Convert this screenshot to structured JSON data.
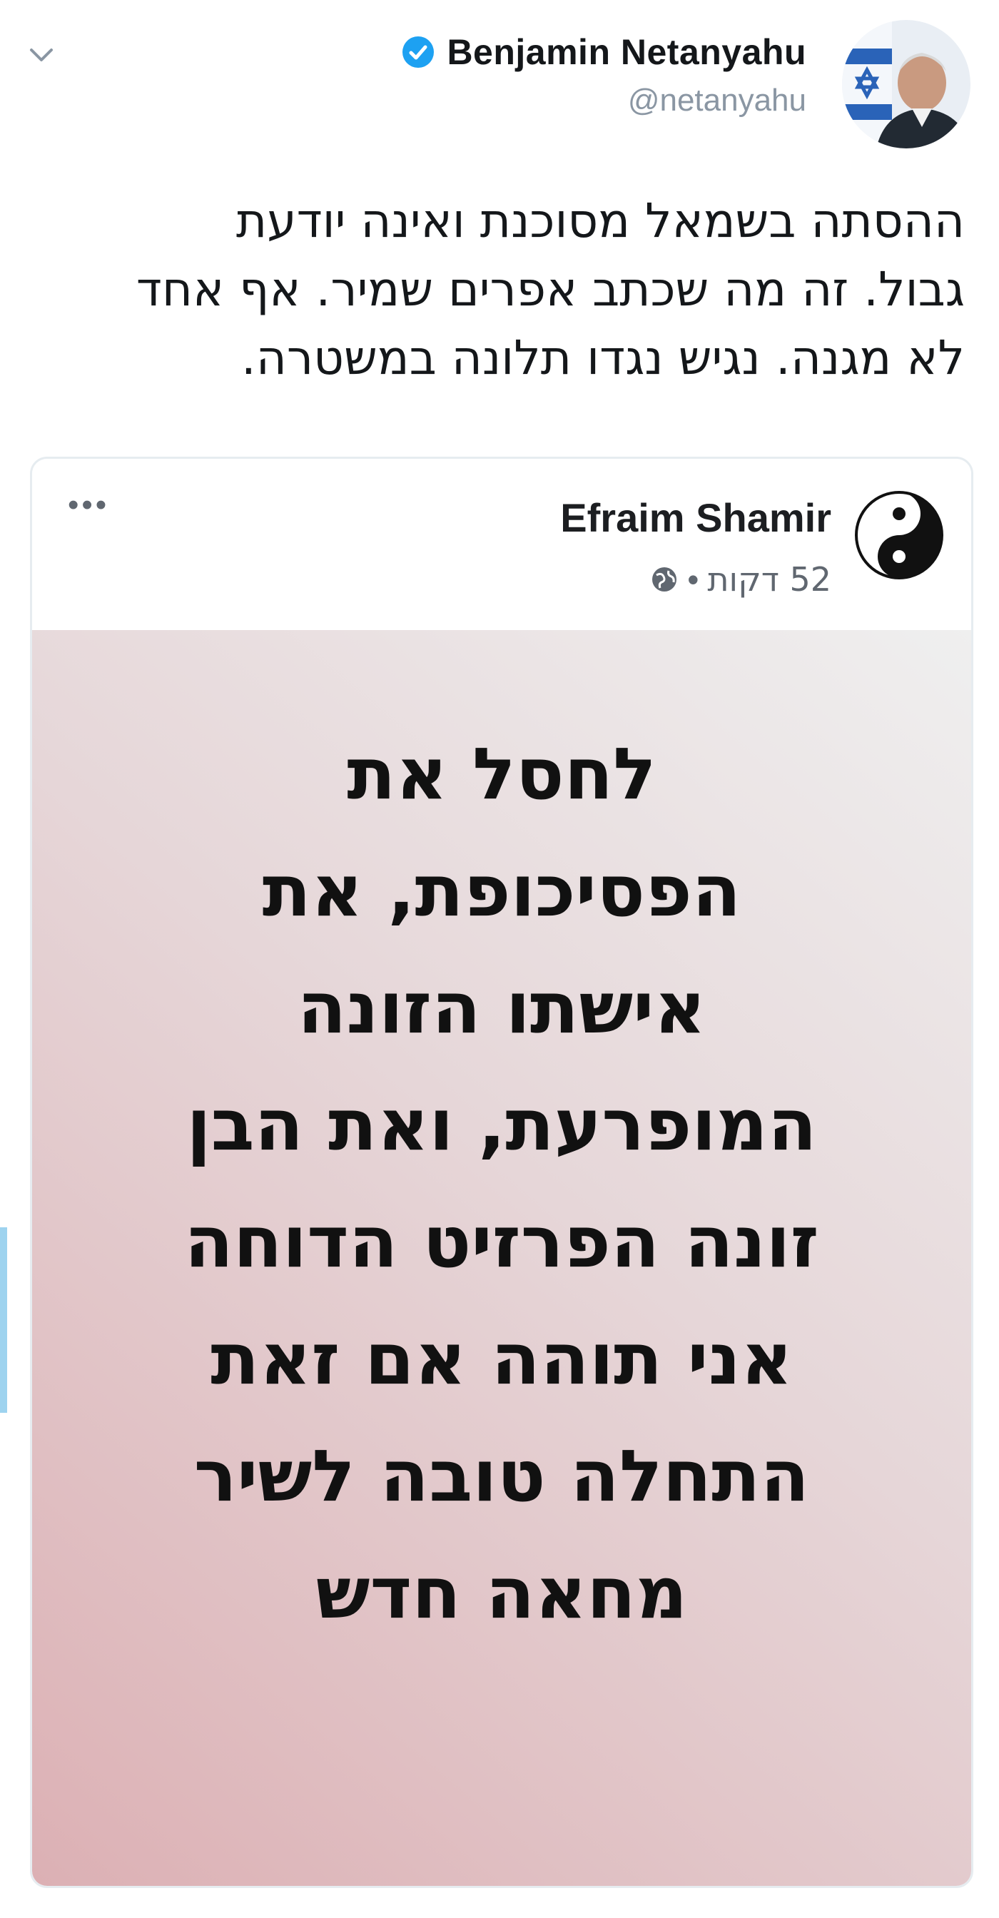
{
  "tweet": {
    "author": {
      "name": "Benjamin Netanyahu",
      "handle": "@netanyahu",
      "verified": true
    },
    "text_lines": [
      "ההסתה בשמאל מסוכנת ואינה יודעת",
      "גבול. זה מה שכתב אפרים שמיר. אף אחד",
      "לא מגנה. נגיש נגדו תלונה במשטרה."
    ]
  },
  "embedded_post": {
    "author_name": "Efraim Shamir",
    "time": "52 דקות",
    "separator": "•",
    "text_lines": [
      "לחסל את",
      "הפסיכופת, את",
      "אישתו הזונה",
      "המופרעת, ואת הבן",
      "זונה הפרזיט הדוחה",
      "אני תוהה אם זאת",
      "התחלה טובה לשיר",
      "מחאה חדש"
    ]
  },
  "icons": {
    "menu": "chevron-down-icon",
    "verified": "verified-badge-icon",
    "avatar_emblem": "flag-star-icon",
    "profile": "yin-yang-icon",
    "privacy": "globe-icon",
    "options": "more-dots-icon"
  },
  "colors": {
    "verified_blue": "#1da1f2",
    "handle_gray": "#8a96a3",
    "text_dark": "#14171a",
    "card_border": "#e6ecf0",
    "post_gradient_start": "#efefef",
    "post_gradient_end": "#dcb0b4"
  }
}
